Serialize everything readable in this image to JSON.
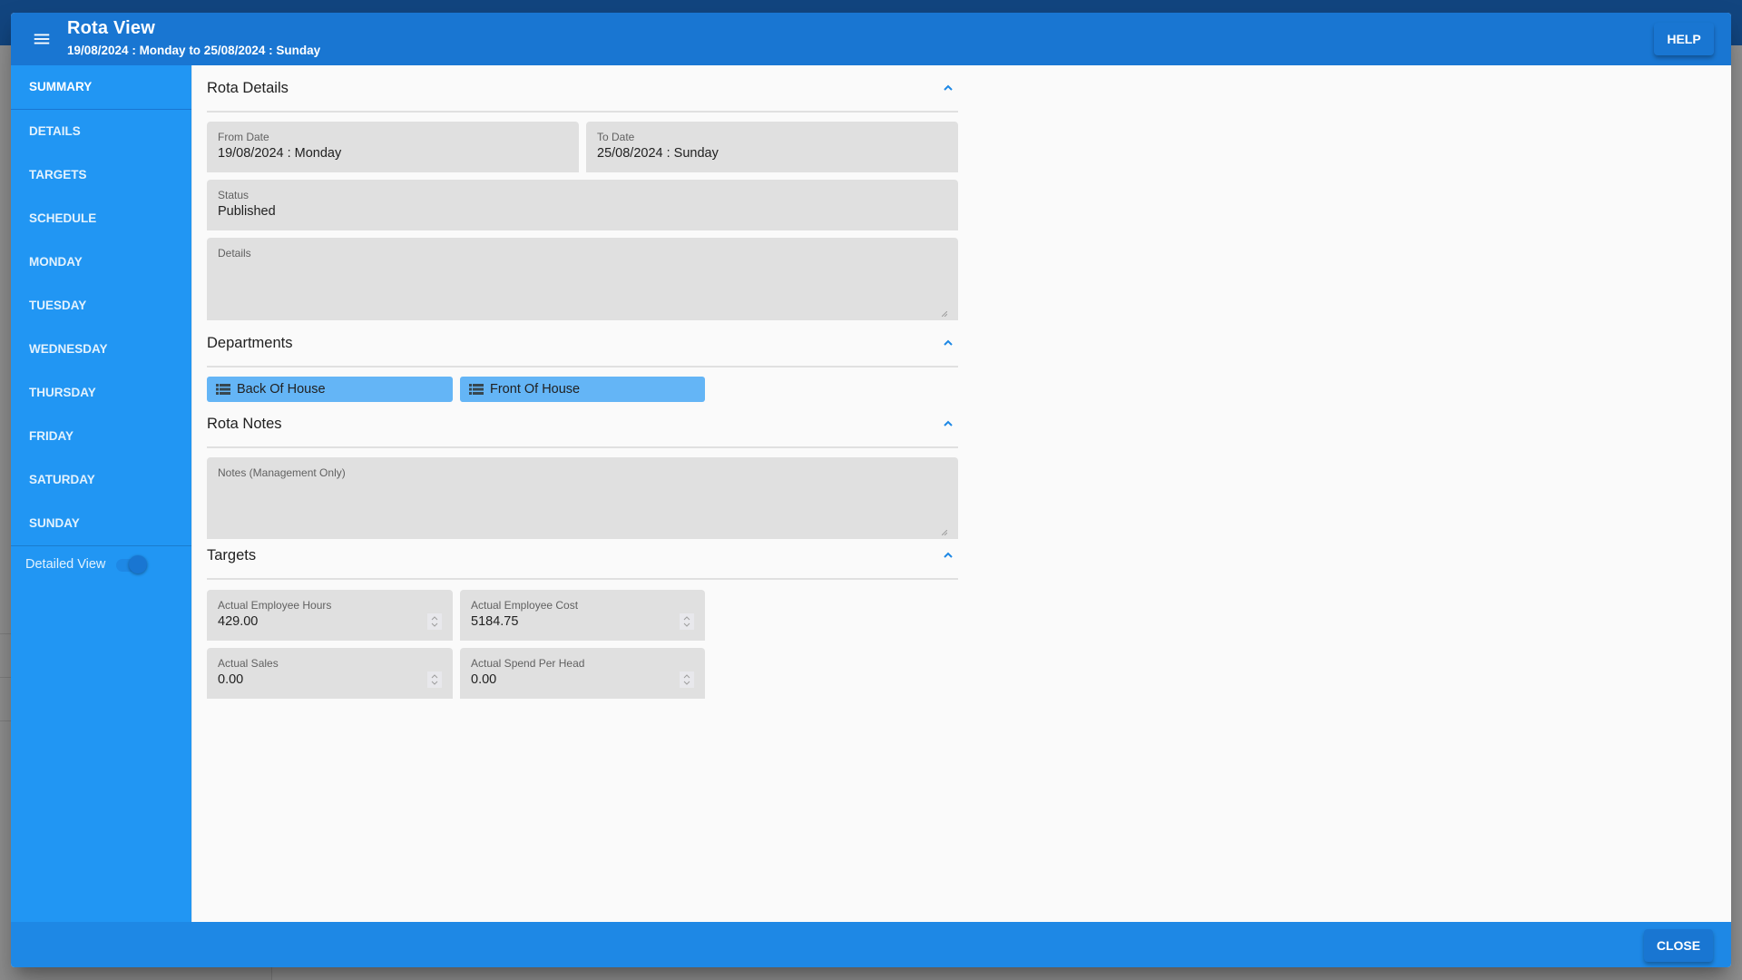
{
  "header": {
    "title": "Rota View",
    "subtitle": "19/08/2024 : Monday to 25/08/2024 : Sunday",
    "menu_icon": "hamburger-menu-icon",
    "help_label": "HELP"
  },
  "sidebar": {
    "items": [
      {
        "label": "SUMMARY",
        "active": true
      },
      {
        "label": "DETAILS"
      },
      {
        "label": "TARGETS"
      },
      {
        "label": "SCHEDULE"
      },
      {
        "label": "MONDAY"
      },
      {
        "label": "TUESDAY"
      },
      {
        "label": "WEDNESDAY"
      },
      {
        "label": "THURSDAY"
      },
      {
        "label": "FRIDAY"
      },
      {
        "label": "SATURDAY"
      },
      {
        "label": "SUNDAY"
      }
    ],
    "toggle": {
      "label": "Detailed View",
      "on": true
    }
  },
  "sections": {
    "rota_details": {
      "title": "Rota Details",
      "from_date": {
        "label": "From Date",
        "value": "19/08/2024 : Monday"
      },
      "to_date": {
        "label": "To Date",
        "value": "25/08/2024 : Sunday"
      },
      "status": {
        "label": "Status",
        "value": "Published"
      },
      "details": {
        "label": "Details",
        "value": ""
      }
    },
    "departments": {
      "title": "Departments",
      "items": [
        {
          "label": "Back Of House",
          "icon": "list-icon"
        },
        {
          "label": "Front Of House",
          "icon": "list-icon"
        }
      ]
    },
    "rota_notes": {
      "title": "Rota Notes",
      "notes": {
        "label": "Notes (Management Only)",
        "value": ""
      }
    },
    "targets": {
      "title": "Targets",
      "fields": [
        {
          "label": "Actual Employee Hours",
          "value": "429.00"
        },
        {
          "label": "Actual Employee Cost",
          "value": "5184.75"
        },
        {
          "label": "Actual Sales",
          "value": "0.00"
        },
        {
          "label": "Actual Spend Per Head",
          "value": "0.00"
        }
      ]
    }
  },
  "footer": {
    "close_label": "CLOSE"
  },
  "colors": {
    "header": "#1976d2",
    "sidebar": "#2196f3",
    "footer": "#1e88e5",
    "chip": "#64b5f6",
    "field": "#e0e0e0"
  }
}
